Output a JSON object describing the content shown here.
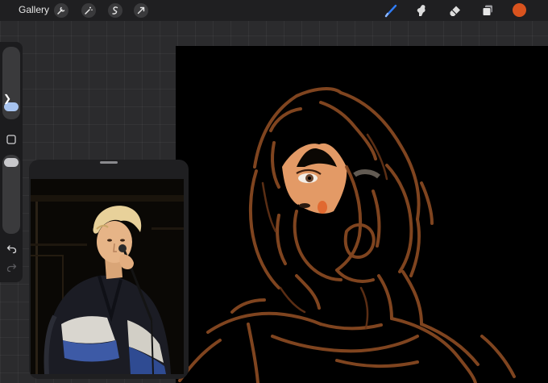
{
  "topbar": {
    "gallery_label": "Gallery",
    "left_tools": [
      "wrench-icon",
      "magic-wand-icon",
      "selection-icon",
      "transform-arrow-icon"
    ],
    "right_tools": [
      "brush-icon",
      "smudge-icon",
      "eraser-icon",
      "layers-icon"
    ],
    "active_tool": "brush-icon",
    "current_color": "#d9531e",
    "brush_tool_color": "#2f7cf6"
  },
  "sidebar": {
    "collapse_glyph": "❯",
    "controls": [
      "brush-size-slider",
      "modify-button",
      "opacity-slider",
      "undo-button",
      "redo-button"
    ]
  },
  "canvas": {
    "background": "#000000",
    "stroke_color": "#8a4a22",
    "skin_color": "#e39a66"
  },
  "reference": {
    "window": "reference-photo-window"
  }
}
